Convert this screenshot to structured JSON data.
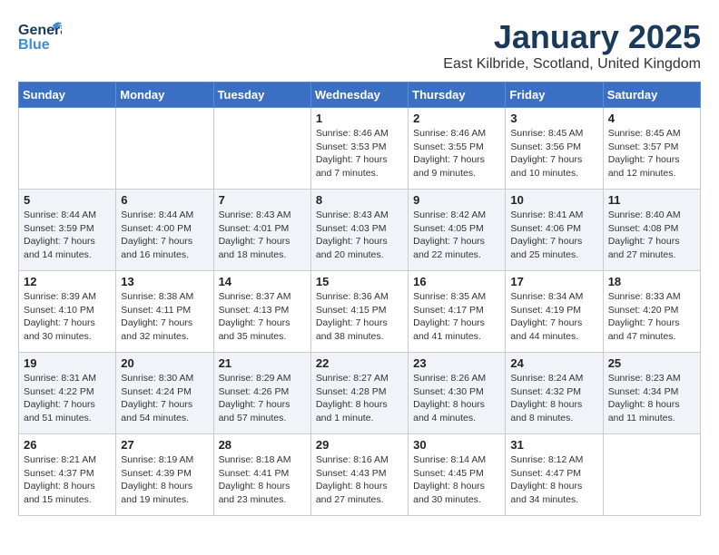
{
  "header": {
    "logo_general": "General",
    "logo_blue": "Blue",
    "month": "January 2025",
    "location": "East Kilbride, Scotland, United Kingdom"
  },
  "days_of_week": [
    "Sunday",
    "Monday",
    "Tuesday",
    "Wednesday",
    "Thursday",
    "Friday",
    "Saturday"
  ],
  "weeks": [
    [
      {
        "day": "",
        "info": ""
      },
      {
        "day": "",
        "info": ""
      },
      {
        "day": "",
        "info": ""
      },
      {
        "day": "1",
        "info": "Sunrise: 8:46 AM\nSunset: 3:53 PM\nDaylight: 7 hours\nand 7 minutes."
      },
      {
        "day": "2",
        "info": "Sunrise: 8:46 AM\nSunset: 3:55 PM\nDaylight: 7 hours\nand 9 minutes."
      },
      {
        "day": "3",
        "info": "Sunrise: 8:45 AM\nSunset: 3:56 PM\nDaylight: 7 hours\nand 10 minutes."
      },
      {
        "day": "4",
        "info": "Sunrise: 8:45 AM\nSunset: 3:57 PM\nDaylight: 7 hours\nand 12 minutes."
      }
    ],
    [
      {
        "day": "5",
        "info": "Sunrise: 8:44 AM\nSunset: 3:59 PM\nDaylight: 7 hours\nand 14 minutes."
      },
      {
        "day": "6",
        "info": "Sunrise: 8:44 AM\nSunset: 4:00 PM\nDaylight: 7 hours\nand 16 minutes."
      },
      {
        "day": "7",
        "info": "Sunrise: 8:43 AM\nSunset: 4:01 PM\nDaylight: 7 hours\nand 18 minutes."
      },
      {
        "day": "8",
        "info": "Sunrise: 8:43 AM\nSunset: 4:03 PM\nDaylight: 7 hours\nand 20 minutes."
      },
      {
        "day": "9",
        "info": "Sunrise: 8:42 AM\nSunset: 4:05 PM\nDaylight: 7 hours\nand 22 minutes."
      },
      {
        "day": "10",
        "info": "Sunrise: 8:41 AM\nSunset: 4:06 PM\nDaylight: 7 hours\nand 25 minutes."
      },
      {
        "day": "11",
        "info": "Sunrise: 8:40 AM\nSunset: 4:08 PM\nDaylight: 7 hours\nand 27 minutes."
      }
    ],
    [
      {
        "day": "12",
        "info": "Sunrise: 8:39 AM\nSunset: 4:10 PM\nDaylight: 7 hours\nand 30 minutes."
      },
      {
        "day": "13",
        "info": "Sunrise: 8:38 AM\nSunset: 4:11 PM\nDaylight: 7 hours\nand 32 minutes."
      },
      {
        "day": "14",
        "info": "Sunrise: 8:37 AM\nSunset: 4:13 PM\nDaylight: 7 hours\nand 35 minutes."
      },
      {
        "day": "15",
        "info": "Sunrise: 8:36 AM\nSunset: 4:15 PM\nDaylight: 7 hours\nand 38 minutes."
      },
      {
        "day": "16",
        "info": "Sunrise: 8:35 AM\nSunset: 4:17 PM\nDaylight: 7 hours\nand 41 minutes."
      },
      {
        "day": "17",
        "info": "Sunrise: 8:34 AM\nSunset: 4:19 PM\nDaylight: 7 hours\nand 44 minutes."
      },
      {
        "day": "18",
        "info": "Sunrise: 8:33 AM\nSunset: 4:20 PM\nDaylight: 7 hours\nand 47 minutes."
      }
    ],
    [
      {
        "day": "19",
        "info": "Sunrise: 8:31 AM\nSunset: 4:22 PM\nDaylight: 7 hours\nand 51 minutes."
      },
      {
        "day": "20",
        "info": "Sunrise: 8:30 AM\nSunset: 4:24 PM\nDaylight: 7 hours\nand 54 minutes."
      },
      {
        "day": "21",
        "info": "Sunrise: 8:29 AM\nSunset: 4:26 PM\nDaylight: 7 hours\nand 57 minutes."
      },
      {
        "day": "22",
        "info": "Sunrise: 8:27 AM\nSunset: 4:28 PM\nDaylight: 8 hours\nand 1 minute."
      },
      {
        "day": "23",
        "info": "Sunrise: 8:26 AM\nSunset: 4:30 PM\nDaylight: 8 hours\nand 4 minutes."
      },
      {
        "day": "24",
        "info": "Sunrise: 8:24 AM\nSunset: 4:32 PM\nDaylight: 8 hours\nand 8 minutes."
      },
      {
        "day": "25",
        "info": "Sunrise: 8:23 AM\nSunset: 4:34 PM\nDaylight: 8 hours\nand 11 minutes."
      }
    ],
    [
      {
        "day": "26",
        "info": "Sunrise: 8:21 AM\nSunset: 4:37 PM\nDaylight: 8 hours\nand 15 minutes."
      },
      {
        "day": "27",
        "info": "Sunrise: 8:19 AM\nSunset: 4:39 PM\nDaylight: 8 hours\nand 19 minutes."
      },
      {
        "day": "28",
        "info": "Sunrise: 8:18 AM\nSunset: 4:41 PM\nDaylight: 8 hours\nand 23 minutes."
      },
      {
        "day": "29",
        "info": "Sunrise: 8:16 AM\nSunset: 4:43 PM\nDaylight: 8 hours\nand 27 minutes."
      },
      {
        "day": "30",
        "info": "Sunrise: 8:14 AM\nSunset: 4:45 PM\nDaylight: 8 hours\nand 30 minutes."
      },
      {
        "day": "31",
        "info": "Sunrise: 8:12 AM\nSunset: 4:47 PM\nDaylight: 8 hours\nand 34 minutes."
      },
      {
        "day": "",
        "info": ""
      }
    ]
  ]
}
